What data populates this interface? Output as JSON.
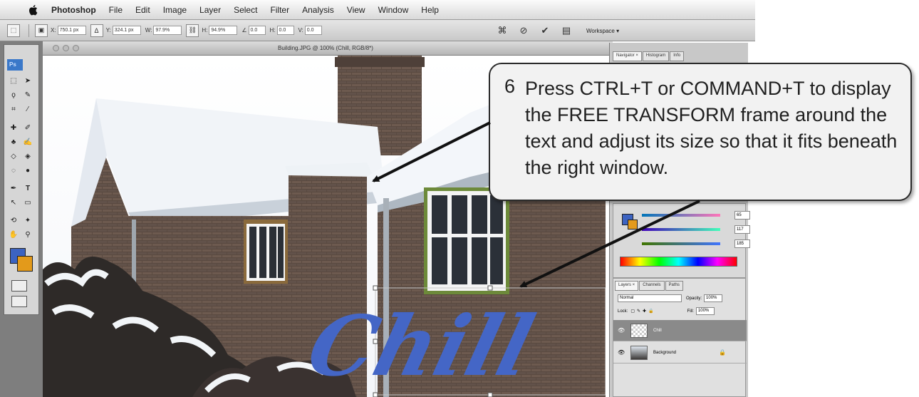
{
  "menubar": {
    "app_name": "Photoshop",
    "items": [
      "File",
      "Edit",
      "Image",
      "Layer",
      "Select",
      "Filter",
      "Analysis",
      "View",
      "Window",
      "Help"
    ]
  },
  "options_bar": {
    "fields": [
      {
        "label": "X:",
        "value": "750.1 px"
      },
      {
        "label": "Y:",
        "value": "324.1 px"
      },
      {
        "label": "W:",
        "value": "97.9%"
      },
      {
        "label": "H:",
        "value": "94.9%"
      },
      {
        "label": "∠",
        "value": "0.0"
      },
      {
        "label": "H:",
        "value": "0.0"
      },
      {
        "label": "V:",
        "value": "0.0"
      }
    ],
    "workspace_label": "Workspace ▾"
  },
  "document": {
    "title": "Building.JPG @ 100% (Chill, RGB/8*)",
    "canvas_text": "Chill",
    "text_color": "#4466c6"
  },
  "tools": {
    "logo": "Ps",
    "foreground_color": "#3c63c1",
    "background_color": "#e39a1b"
  },
  "panels": {
    "top_tabs": [
      "Navigator ×",
      "Histogram",
      "Info"
    ],
    "color_values": [
      "65",
      "117",
      "185"
    ],
    "layers_tabs": [
      "Layers ×",
      "Channels",
      "Paths"
    ],
    "blend_mode": "Normal",
    "opacity_label": "Opacity:",
    "opacity_value": "100%",
    "lock_label": "Lock:",
    "fill_label": "Fill:",
    "fill_value": "100%",
    "layers": [
      {
        "name": "Chill",
        "selected": true
      },
      {
        "name": "Background",
        "selected": false
      }
    ]
  },
  "callout": {
    "number": "6",
    "text": "Press CTRL+T or COMMAND+T to display the FREE TRANSFORM frame around the text and adjust its size so that it fits beneath the right window."
  }
}
